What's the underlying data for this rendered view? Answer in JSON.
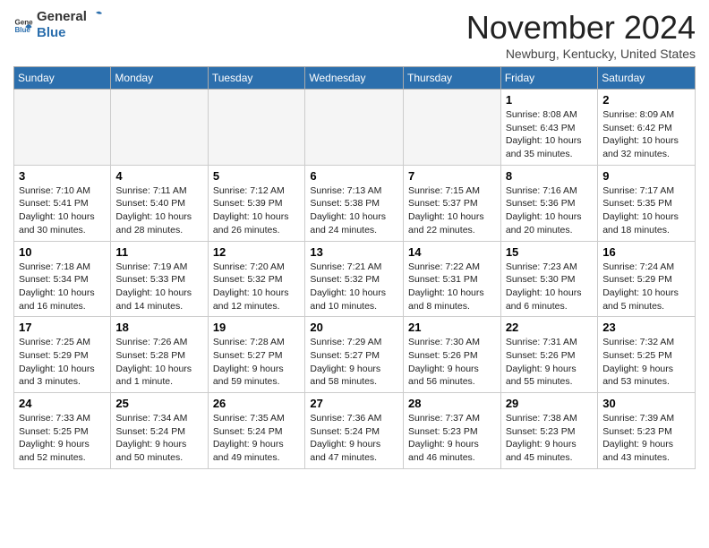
{
  "header": {
    "logo_general": "General",
    "logo_blue": "Blue",
    "month_title": "November 2024",
    "location": "Newburg, Kentucky, United States"
  },
  "days_of_week": [
    "Sunday",
    "Monday",
    "Tuesday",
    "Wednesday",
    "Thursday",
    "Friday",
    "Saturday"
  ],
  "weeks": [
    [
      {
        "day": "",
        "empty": true
      },
      {
        "day": "",
        "empty": true
      },
      {
        "day": "",
        "empty": true
      },
      {
        "day": "",
        "empty": true
      },
      {
        "day": "",
        "empty": true
      },
      {
        "day": "1",
        "sunrise": "8:08 AM",
        "sunset": "6:43 PM",
        "daylight": "10 hours and 35 minutes."
      },
      {
        "day": "2",
        "sunrise": "8:09 AM",
        "sunset": "6:42 PM",
        "daylight": "10 hours and 32 minutes."
      }
    ],
    [
      {
        "day": "3",
        "sunrise": "7:10 AM",
        "sunset": "5:41 PM",
        "daylight": "10 hours and 30 minutes."
      },
      {
        "day": "4",
        "sunrise": "7:11 AM",
        "sunset": "5:40 PM",
        "daylight": "10 hours and 28 minutes."
      },
      {
        "day": "5",
        "sunrise": "7:12 AM",
        "sunset": "5:39 PM",
        "daylight": "10 hours and 26 minutes."
      },
      {
        "day": "6",
        "sunrise": "7:13 AM",
        "sunset": "5:38 PM",
        "daylight": "10 hours and 24 minutes."
      },
      {
        "day": "7",
        "sunrise": "7:15 AM",
        "sunset": "5:37 PM",
        "daylight": "10 hours and 22 minutes."
      },
      {
        "day": "8",
        "sunrise": "7:16 AM",
        "sunset": "5:36 PM",
        "daylight": "10 hours and 20 minutes."
      },
      {
        "day": "9",
        "sunrise": "7:17 AM",
        "sunset": "5:35 PM",
        "daylight": "10 hours and 18 minutes."
      }
    ],
    [
      {
        "day": "10",
        "sunrise": "7:18 AM",
        "sunset": "5:34 PM",
        "daylight": "10 hours and 16 minutes."
      },
      {
        "day": "11",
        "sunrise": "7:19 AM",
        "sunset": "5:33 PM",
        "daylight": "10 hours and 14 minutes."
      },
      {
        "day": "12",
        "sunrise": "7:20 AM",
        "sunset": "5:32 PM",
        "daylight": "10 hours and 12 minutes."
      },
      {
        "day": "13",
        "sunrise": "7:21 AM",
        "sunset": "5:32 PM",
        "daylight": "10 hours and 10 minutes."
      },
      {
        "day": "14",
        "sunrise": "7:22 AM",
        "sunset": "5:31 PM",
        "daylight": "10 hours and 8 minutes."
      },
      {
        "day": "15",
        "sunrise": "7:23 AM",
        "sunset": "5:30 PM",
        "daylight": "10 hours and 6 minutes."
      },
      {
        "day": "16",
        "sunrise": "7:24 AM",
        "sunset": "5:29 PM",
        "daylight": "10 hours and 5 minutes."
      }
    ],
    [
      {
        "day": "17",
        "sunrise": "7:25 AM",
        "sunset": "5:29 PM",
        "daylight": "10 hours and 3 minutes."
      },
      {
        "day": "18",
        "sunrise": "7:26 AM",
        "sunset": "5:28 PM",
        "daylight": "10 hours and 1 minute."
      },
      {
        "day": "19",
        "sunrise": "7:28 AM",
        "sunset": "5:27 PM",
        "daylight": "9 hours and 59 minutes."
      },
      {
        "day": "20",
        "sunrise": "7:29 AM",
        "sunset": "5:27 PM",
        "daylight": "9 hours and 58 minutes."
      },
      {
        "day": "21",
        "sunrise": "7:30 AM",
        "sunset": "5:26 PM",
        "daylight": "9 hours and 56 minutes."
      },
      {
        "day": "22",
        "sunrise": "7:31 AM",
        "sunset": "5:26 PM",
        "daylight": "9 hours and 55 minutes."
      },
      {
        "day": "23",
        "sunrise": "7:32 AM",
        "sunset": "5:25 PM",
        "daylight": "9 hours and 53 minutes."
      }
    ],
    [
      {
        "day": "24",
        "sunrise": "7:33 AM",
        "sunset": "5:25 PM",
        "daylight": "9 hours and 52 minutes."
      },
      {
        "day": "25",
        "sunrise": "7:34 AM",
        "sunset": "5:24 PM",
        "daylight": "9 hours and 50 minutes."
      },
      {
        "day": "26",
        "sunrise": "7:35 AM",
        "sunset": "5:24 PM",
        "daylight": "9 hours and 49 minutes."
      },
      {
        "day": "27",
        "sunrise": "7:36 AM",
        "sunset": "5:24 PM",
        "daylight": "9 hours and 47 minutes."
      },
      {
        "day": "28",
        "sunrise": "7:37 AM",
        "sunset": "5:23 PM",
        "daylight": "9 hours and 46 minutes."
      },
      {
        "day": "29",
        "sunrise": "7:38 AM",
        "sunset": "5:23 PM",
        "daylight": "9 hours and 45 minutes."
      },
      {
        "day": "30",
        "sunrise": "7:39 AM",
        "sunset": "5:23 PM",
        "daylight": "9 hours and 43 minutes."
      }
    ]
  ]
}
